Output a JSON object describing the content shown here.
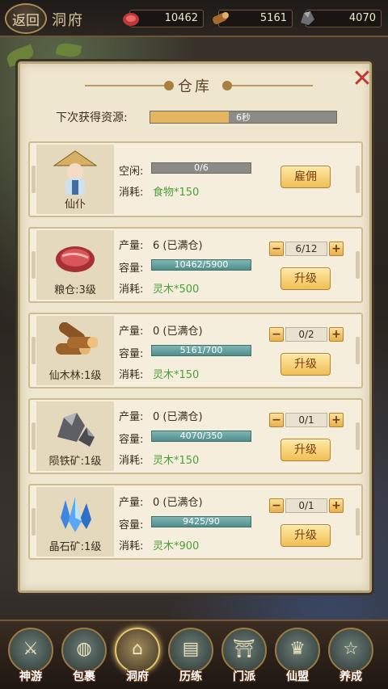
{
  "topbar": {
    "back_label": "返回",
    "page_name": "洞府",
    "resources": [
      {
        "icon": "meat-icon",
        "value": "10462"
      },
      {
        "icon": "wood-icon",
        "value": "5161"
      },
      {
        "icon": "iron-ore-icon",
        "value": "4070"
      }
    ]
  },
  "panel": {
    "title": "仓库",
    "next_label": "下次获得资源:",
    "next_value": "6秒",
    "next_progress": 0.42
  },
  "worker": {
    "name": "仙仆",
    "idle_label": "空闲:",
    "idle_value": "0/6",
    "cost_label": "消耗:",
    "cost_value": "食物*150",
    "button": "雇佣"
  },
  "buildings": [
    {
      "name": "粮仓:3级",
      "icon": "meat-icon",
      "output_label": "产量:",
      "output_value": "6 (已满仓)",
      "cap_label": "容量:",
      "cap_value": "10462/5900",
      "cost_label": "消耗:",
      "cost_value": "灵木*500",
      "count": "6/12",
      "button": "升级"
    },
    {
      "name": "仙木林:1级",
      "icon": "wood-icon",
      "output_label": "产量:",
      "output_value": "0 (已满仓)",
      "cap_label": "容量:",
      "cap_value": "5161/700",
      "cost_label": "消耗:",
      "cost_value": "灵木*150",
      "count": "0/2",
      "button": "升级"
    },
    {
      "name": "陨铁矿:1级",
      "icon": "iron-ore-icon",
      "output_label": "产量:",
      "output_value": "0 (已满仓)",
      "cap_label": "容量:",
      "cap_value": "4070/350",
      "cost_label": "消耗:",
      "cost_value": "灵木*150",
      "count": "0/1",
      "button": "升级"
    },
    {
      "name": "晶石矿:1级",
      "icon": "crystal-icon",
      "output_label": "产量:",
      "output_value": "0 (已满仓)",
      "cap_label": "容量:",
      "cap_value": "9425/90",
      "cost_label": "消耗:",
      "cost_value": "灵木*900",
      "count": "0/1",
      "button": "升级"
    }
  ],
  "nav": [
    {
      "label": "神游",
      "icon": "swords-icon"
    },
    {
      "label": "包裹",
      "icon": "bag-icon"
    },
    {
      "label": "洞府",
      "icon": "palace-icon"
    },
    {
      "label": "历练",
      "icon": "scroll-icon"
    },
    {
      "label": "门派",
      "icon": "gate-icon"
    },
    {
      "label": "仙盟",
      "icon": "alliance-icon"
    },
    {
      "label": "养成",
      "icon": "pentagram-icon"
    }
  ],
  "colors": {
    "panel_bg": "#efe6d0",
    "gold_button": "#f0bf55",
    "teal_bar": "#4f8e8c",
    "progress_fill": "#e5b560",
    "cost_green": "#4c9f3a",
    "close_red": "#c0392b"
  }
}
